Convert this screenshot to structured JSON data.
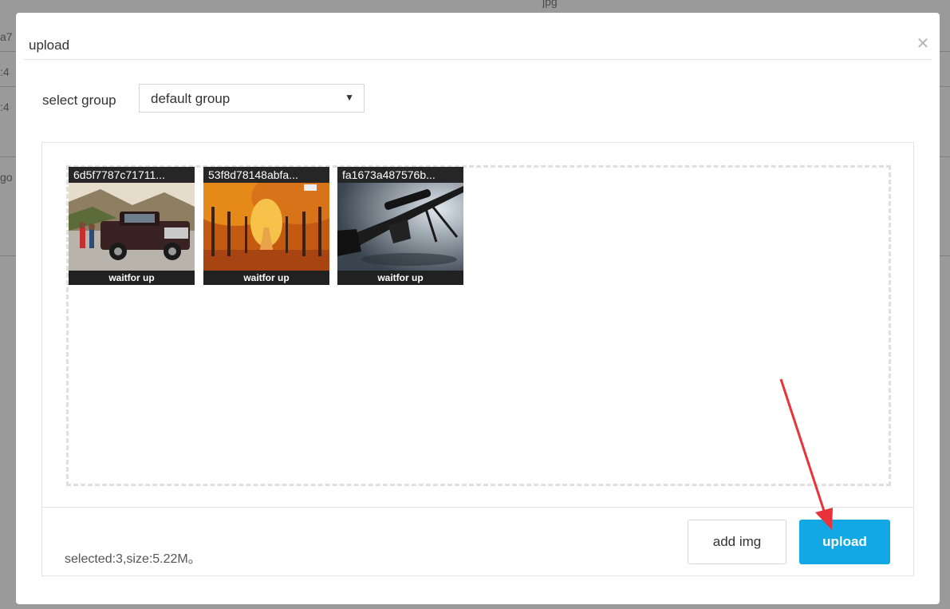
{
  "background": {
    "snippets": [
      "a7",
      ":4",
      ":4",
      "go",
      "jpg"
    ]
  },
  "modal": {
    "title": "upload",
    "close_icon": "close-icon"
  },
  "group": {
    "label": "select group",
    "selected": "default group"
  },
  "images": [
    {
      "name": "6d5f7787c71711...",
      "status": "waitfor up",
      "subject": "truck"
    },
    {
      "name": "53f8d78148abfa...",
      "status": "waitfor up",
      "subject": "autumn-trees"
    },
    {
      "name": "fa1673a487576b...",
      "status": "waitfor up",
      "subject": "rifle"
    }
  ],
  "footer": {
    "summary": "selected:3,size:5.22M。",
    "add_label": "add img",
    "upload_label": "upload"
  },
  "colors": {
    "primary": "#12a8e6",
    "annotation_arrow": "#e8333a"
  }
}
